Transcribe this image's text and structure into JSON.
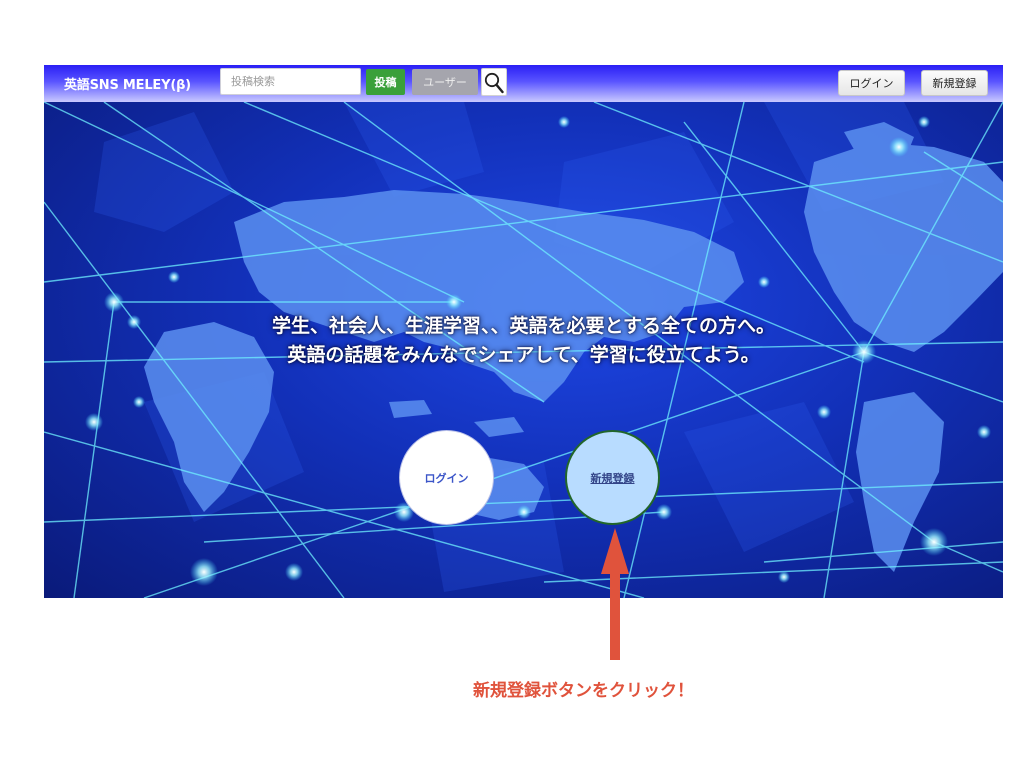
{
  "navbar": {
    "brand": "英語SNS MELEY(β)",
    "search_placeholder": "投稿検索",
    "post_button": "投稿",
    "user_button": "ユーザー",
    "search_icon": "magnifier-icon",
    "login_button": "ログイン",
    "signup_button": "新規登録",
    "colors": {
      "bar_top": "#2a1ff5",
      "post_green": "#3aa03a"
    }
  },
  "hero": {
    "tagline_line1": "学生、社会人、生涯学習、、英語を必要とする全ての方へ。",
    "tagline_line2": "英語の話題をみんなでシェアして、学習に役立てよう。",
    "login_circle": "ログイン",
    "signup_circle": "新規登録",
    "background": "world-network-map"
  },
  "annotation": {
    "text": "新規登録ボタンをクリック！",
    "color": "#e0533c"
  }
}
